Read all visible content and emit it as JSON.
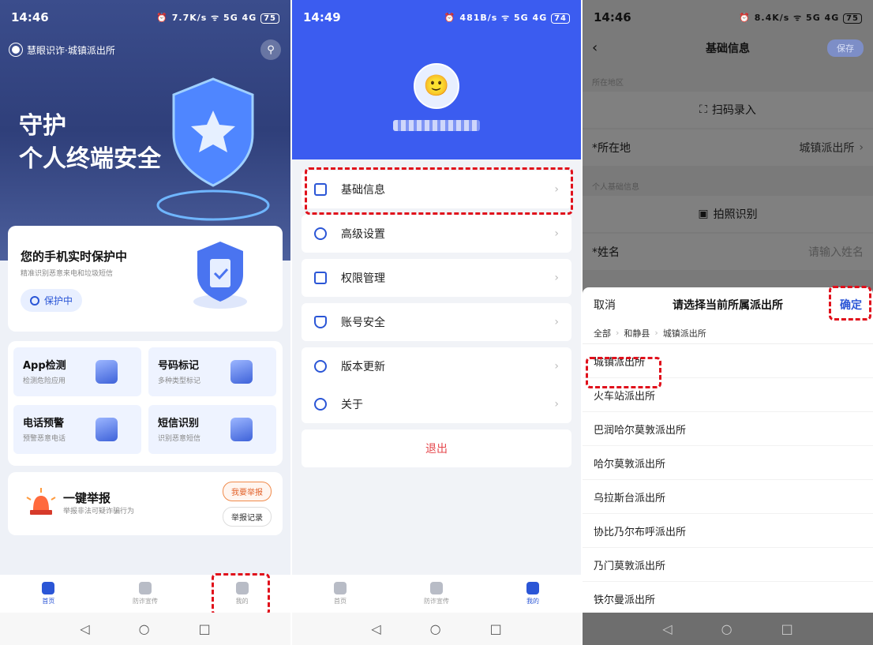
{
  "panel1": {
    "status": {
      "time": "14:46",
      "icons": "⏰ 7.7K/s ᯤ 5G 4G",
      "battery": "75"
    },
    "app_name": "慧眼识诈·城镇派出所",
    "hero_line1": "守护",
    "hero_line2": "个人终端安全",
    "protect_card": {
      "title": "您的手机实时保护中",
      "subtitle": "精准识别恶意来电和垃圾短信",
      "button": "保护中"
    },
    "tiles": [
      {
        "title": "App检测",
        "subtitle": "检测危险应用"
      },
      {
        "title": "号码标记",
        "subtitle": "多种类型标记"
      },
      {
        "title": "电话预警",
        "subtitle": "预警恶意电话"
      },
      {
        "title": "短信识别",
        "subtitle": "识别恶意短信"
      }
    ],
    "report": {
      "title": "一键举报",
      "subtitle": "举报非法可疑诈骗行为",
      "btn_report": "我要举报",
      "btn_record": "举报记录"
    },
    "tabs": [
      "首页",
      "防诈宣传",
      "我的"
    ]
  },
  "panel2": {
    "status": {
      "time": "14:49",
      "icons": "⏰ 481B/s ᯤ 5G 4G",
      "battery": "74"
    },
    "menu": [
      "基础信息",
      "高级设置",
      "权限管理",
      "账号安全",
      "版本更新",
      "关于"
    ],
    "logout": "退出",
    "tabs": [
      "首页",
      "防诈宣传",
      "我的"
    ]
  },
  "panel3": {
    "status": {
      "time": "14:46",
      "icons": "⏰ 8.4K/s ᯤ 5G 4G",
      "battery": "75"
    },
    "title": "基础信息",
    "save": "保存",
    "sec_region": "所在地区",
    "scan": "扫码录入",
    "location_label": "*所在地",
    "location_value": "城镇派出所",
    "sec_personal": "个人基础信息",
    "photo": "拍照识别",
    "name_label": "*姓名",
    "name_placeholder": "请输入姓名",
    "sheet": {
      "cancel": "取消",
      "title": "请选择当前所属派出所",
      "confirm": "确定",
      "crumbs": [
        "全部",
        "和静县",
        "城镇派出所"
      ],
      "options": [
        "城镇派出所",
        "火车站派出所",
        "巴润哈尔莫敦派出所",
        "哈尔莫敦派出所",
        "乌拉斯台派出所",
        "协比乃尔布呼派出所",
        "乃门莫敦派出所",
        "铁尔曼派出所"
      ]
    }
  },
  "colors": {
    "primary": "#2b56d6",
    "header_blue": "#3b5cf0",
    "highlight_red": "#e0101b",
    "logout_red": "#e5484d"
  }
}
